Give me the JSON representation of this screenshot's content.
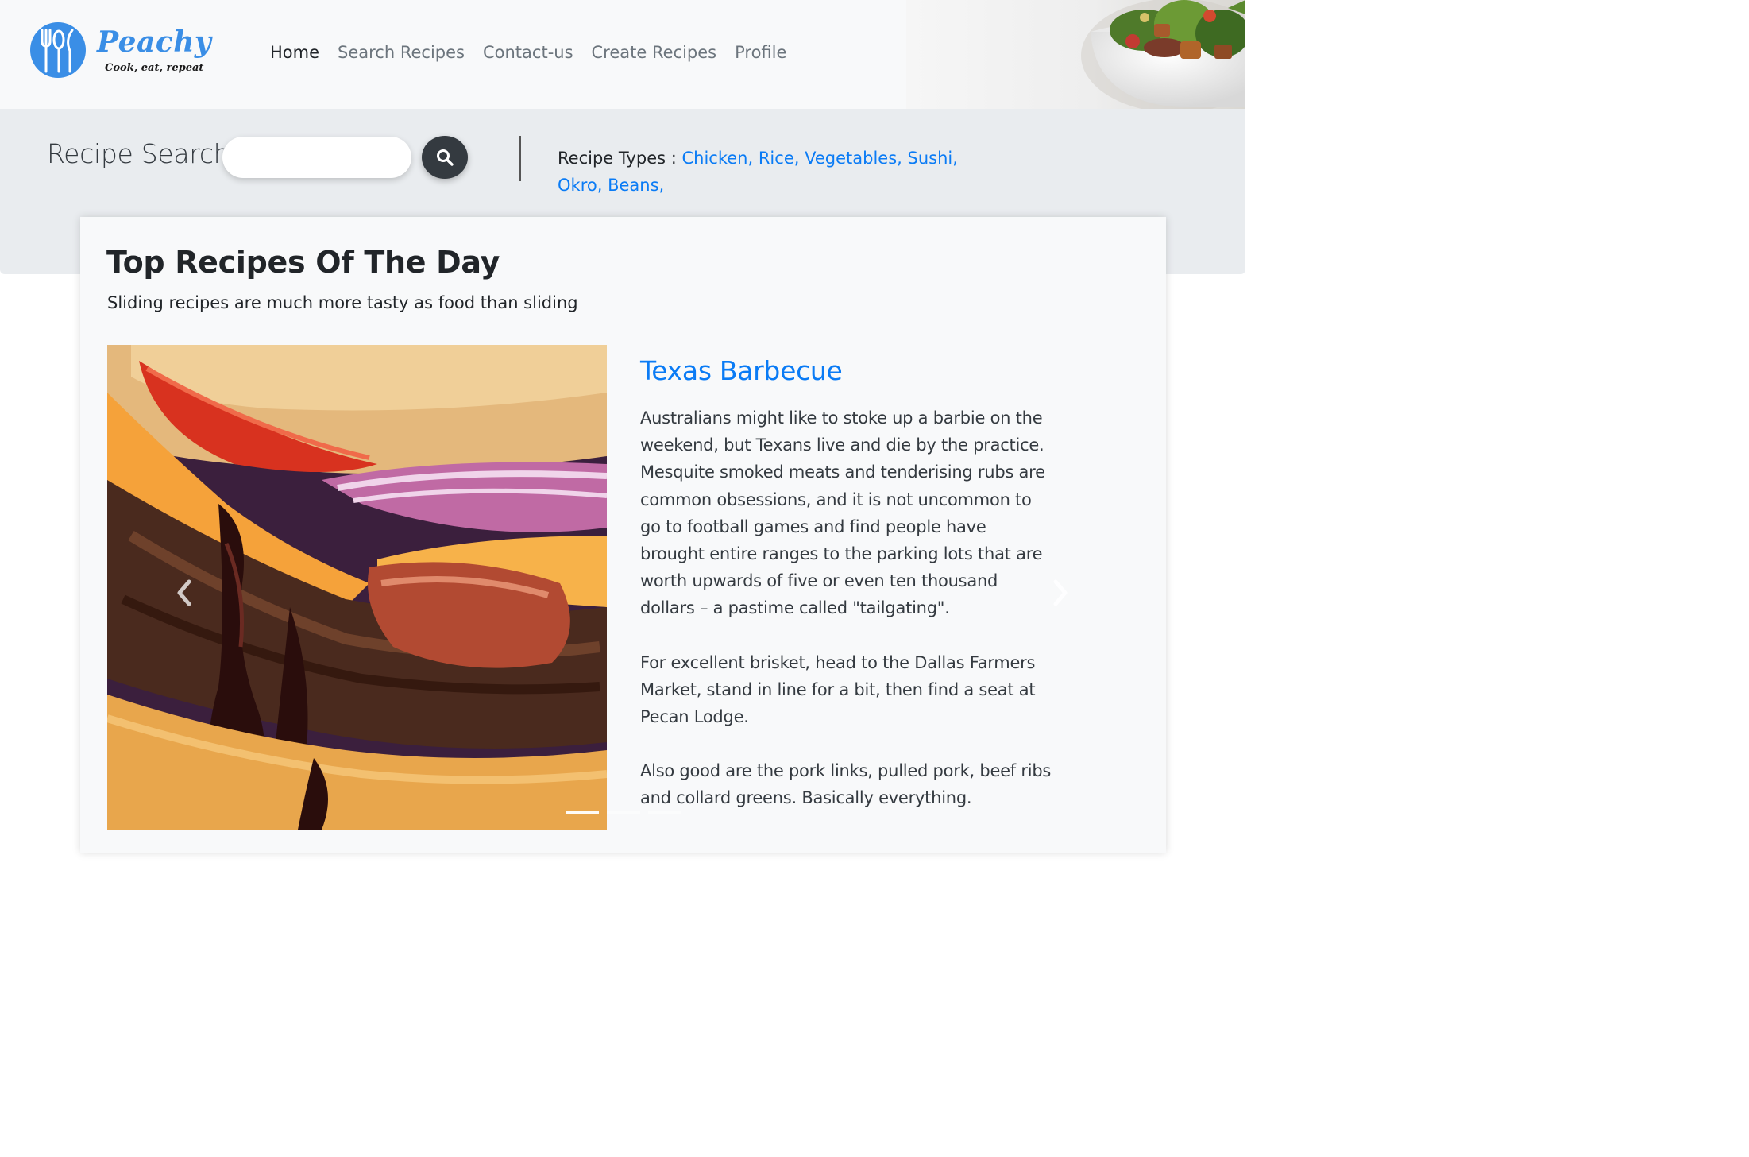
{
  "brand": {
    "name": "Peachy",
    "tagline": "Cook, eat, repeat",
    "color": "#3a8ee6"
  },
  "nav": {
    "items": [
      {
        "label": "Home",
        "active": true
      },
      {
        "label": "Search Recipes",
        "active": false
      },
      {
        "label": "Contact-us",
        "active": false
      },
      {
        "label": "Create Recipes",
        "active": false
      },
      {
        "label": "Profile",
        "active": false
      }
    ]
  },
  "search": {
    "title": "Recipe Search",
    "placeholder": "",
    "button_icon": "search-icon"
  },
  "recipe_types": {
    "label": "Recipe Types : ",
    "items": [
      "Chicken,",
      "Rice,",
      "Vegetables,",
      "Sushi,",
      "Okro,",
      "Beans,"
    ],
    "link_color": "#0a7bf5"
  },
  "card": {
    "title": "Top Recipes Of The Day",
    "subtitle": "Sliding recipes are much more tasty as food than sliding"
  },
  "carousel": {
    "prev_icon": "chevron-left-icon",
    "next_icon": "chevron-right-icon",
    "slide_count": 3,
    "active_index": 0
  },
  "recipe": {
    "title": "Texas Barbecue",
    "paragraphs": [
      "Australians might like to stoke up a barbie on the weekend, but Texans live and die by the practice. Mesquite smoked meats and tenderising rubs are common obsessions, and it is not uncommon to go to football games and find people have brought entire ranges to the parking lots that are worth upwards of five or even ten thousand dollars – a pastime called \"tailgating\".",
      "For excellent brisket, head to the Dallas Farmers Market, stand in line for a bit, then find a seat at Pecan Lodge.",
      "Also good are the pork links, pulled pork, beef ribs and collard greens. Basically everything."
    ]
  }
}
